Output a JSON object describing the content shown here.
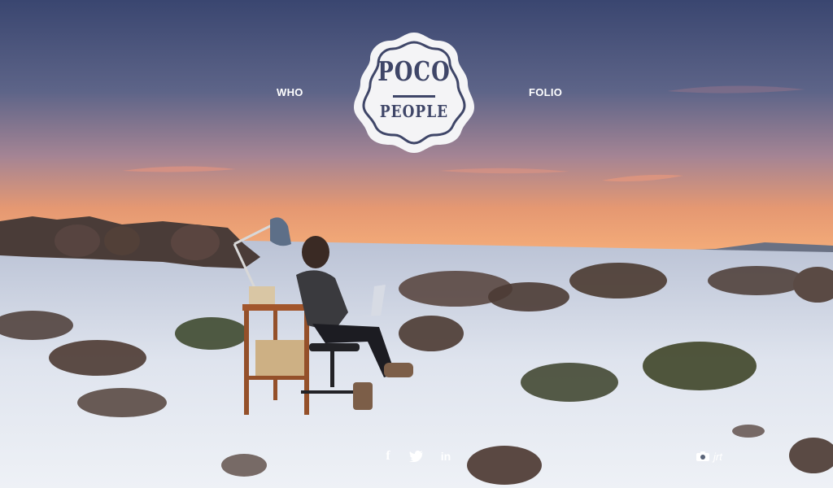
{
  "nav": {
    "who_label": "WHO",
    "folio_label": "FOLIO"
  },
  "logo": {
    "line1": "POCO",
    "line2": "PEOPLE"
  },
  "social": {
    "facebook_icon": "facebook-icon",
    "twitter_icon": "twitter-icon",
    "linkedin_icon": "linkedin-icon",
    "facebook_glyph": "f",
    "linkedin_glyph": "in"
  },
  "photo_credit": {
    "icon": "camera-icon",
    "text": "jrt"
  },
  "colors": {
    "logo_ink": "#3f4668",
    "sky_top": "#3c4a72",
    "horizon": "#f2a06a",
    "snow": "#e8ecf2"
  }
}
